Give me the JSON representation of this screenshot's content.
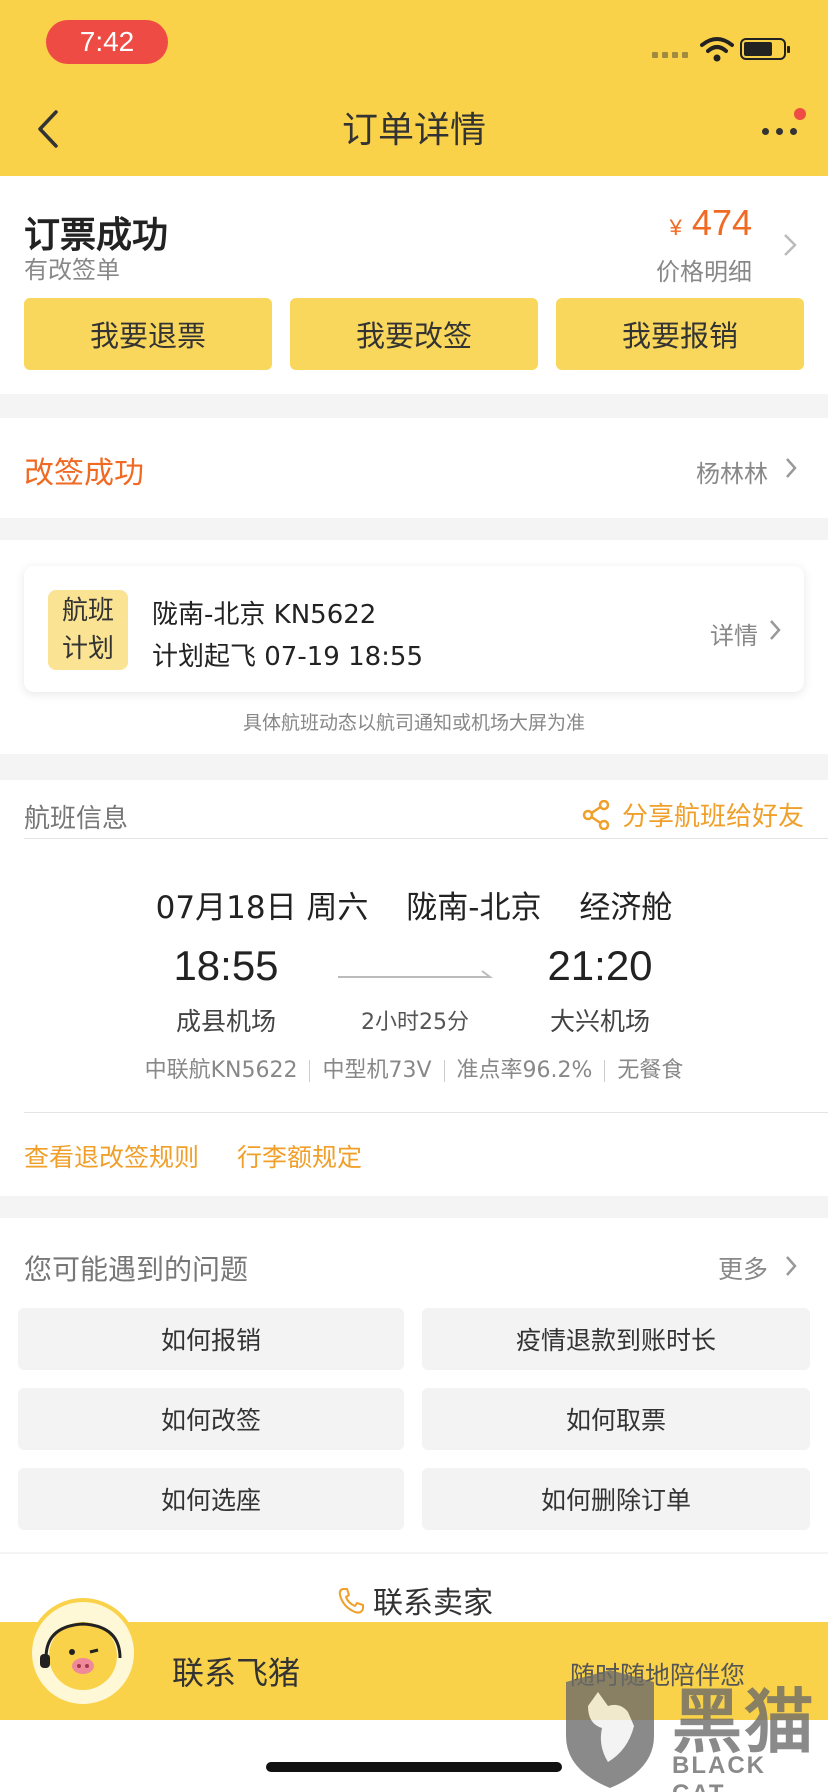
{
  "status_bar": {
    "time": "7:42"
  },
  "header": {
    "title": "订单详情"
  },
  "order": {
    "status": "订票成功",
    "sub_status": "有改签单",
    "currency": "¥",
    "price": "474",
    "price_label": "价格明细",
    "actions": [
      "我要退票",
      "我要改签",
      "我要报销"
    ]
  },
  "change": {
    "title": "改签成功",
    "passenger": "杨林林"
  },
  "plan": {
    "badge_line1": "航班",
    "badge_line2": "计划",
    "route_flight": "陇南-北京 KN5622",
    "departure": "计划起飞 07-19 18:55",
    "detail_label": "详情",
    "note": "具体航班动态以航司通知或机场大屏为准"
  },
  "flight_info": {
    "section_title": "航班信息",
    "share_label": "分享航班给好友",
    "date": "07月18日 周六",
    "route": "陇南-北京",
    "cabin": "经济舱",
    "dep_time": "18:55",
    "dep_airport": "成县机场",
    "arr_time": "21:20",
    "arr_airport": "大兴机场",
    "duration": "2小时25分",
    "airline": "中联航KN5622",
    "aircraft": "中型机73V",
    "on_time": "准点率96.2%",
    "meal": "无餐食",
    "link_rules": "查看退改签规则",
    "link_baggage": "行李额规定"
  },
  "faq": {
    "title": "您可能遇到的问题",
    "more": "更多",
    "items": [
      "如何报销",
      "疫情退款到账时长",
      "如何改签",
      "如何取票",
      "如何选座",
      "如何删除订单"
    ]
  },
  "contact": {
    "seller": "联系卖家"
  },
  "bottom": {
    "label": "联系飞猪",
    "tagline": "随时随地陪伴您"
  },
  "watermark": {
    "text": "黑猫",
    "sub": "BLACK CAT"
  },
  "colors": {
    "header": "#f9d24a",
    "accent": "#f06a23",
    "link": "#f0a02a",
    "button": "#f9d75c"
  },
  "icons": [
    "back-arrow-icon",
    "more-icon",
    "wifi-icon",
    "battery-icon",
    "chevron-right-icon",
    "share-icon",
    "phone-icon",
    "pig-mascot-icon",
    "black-cat-logo-icon"
  ]
}
